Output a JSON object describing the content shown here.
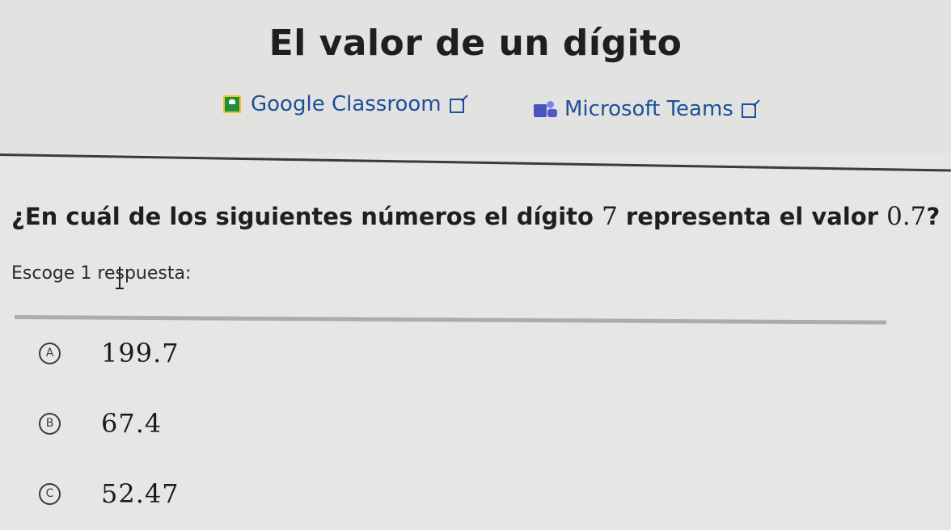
{
  "header": {
    "title": "El valor de un dígito",
    "share_links": [
      {
        "label": "Google Classroom",
        "icon": "google-classroom-icon"
      },
      {
        "label": "Microsoft Teams",
        "icon": "microsoft-teams-icon"
      }
    ]
  },
  "question": {
    "text_before": "¿En cuál de los siguientes números el dígito ",
    "digit": "7",
    "text_middle": " representa el valor ",
    "value": "0.7",
    "text_after": "?"
  },
  "instruction": "Escoge 1 respuesta:",
  "choices": [
    {
      "letter": "A",
      "value": "199.7"
    },
    {
      "letter": "B",
      "value": "67.4"
    },
    {
      "letter": "C",
      "value": "52.47"
    }
  ],
  "colors": {
    "link": "#1d4f9a",
    "google_classroom_green": "#1e8e3e",
    "teams_purple": "#4b53bc"
  }
}
